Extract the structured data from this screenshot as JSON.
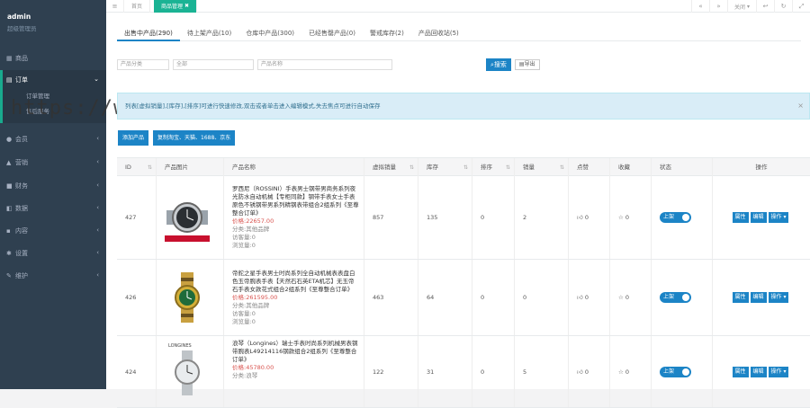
{
  "profile": {
    "name": "admin",
    "role": "超级管理员"
  },
  "sidebar": {
    "items": [
      {
        "label": "商品",
        "icon": "grid-icon"
      },
      {
        "label": "订单",
        "icon": "cart-icon"
      },
      {
        "label": "会员",
        "icon": "user-icon"
      },
      {
        "label": "营销",
        "icon": "flag-icon"
      },
      {
        "label": "财务",
        "icon": "money-icon"
      },
      {
        "label": "数据",
        "icon": "chart-icon"
      },
      {
        "label": "内容",
        "icon": "doc-icon"
      },
      {
        "label": "设置",
        "icon": "gear-icon"
      },
      {
        "label": "维护",
        "icon": "wrench-icon"
      }
    ],
    "sub": [
      "订单管理",
      "售后服务"
    ]
  },
  "topbar": {
    "tabs": [
      "首页",
      "商品管理"
    ],
    "close_label": "关闭"
  },
  "tabs": [
    "出售中产品(290)",
    "待上架产品(10)",
    "仓库中产品(300)",
    "已经售罄产品(0)",
    "警戒库存(2)",
    "产品回收站(5)"
  ],
  "filter": {
    "input1": "产品分类",
    "input2": "全部",
    "input3": "产品名称",
    "search_label": "搜索",
    "export_label": "导出"
  },
  "watermark": "https://www.huzhan.com/ishop23148",
  "alert": {
    "text": "列表[虚拟销量],[库存],[排序]可进行快速修改,双击或者单击进入编辑模式,失去焦点可进行自动保存"
  },
  "buttons": {
    "add": "添加产品",
    "copy": "复制淘宝、天猫、1688、京东"
  },
  "table": {
    "headers": [
      "ID",
      "产品图片",
      "产品名称",
      "虚拟销量",
      "库存",
      "排序",
      "销量",
      "点赞",
      "收藏",
      "状态",
      "操作"
    ],
    "rows": [
      {
        "id": "427",
        "name": "罗西尼（ROSSINI）手表男士钢带男商务系列夜光防水自动机械【专柜同款】钢带手表女士手表原色不锈钢带男系列精钢表带组合2组系列《至尊整合订单》",
        "price": "价格:22657.00",
        "cat": "分类:其他品牌",
        "visits": "访客量:0",
        "views": "浏览量:0",
        "virtual": "857",
        "stock": "135",
        "sort": "0",
        "sales": "2",
        "likes": "0",
        "collects": "0",
        "status": "上架"
      },
      {
        "id": "426",
        "name": "帝舵之星手表男士时尚系列全自动机械表表盘白色玉帝腕表手表【天然石石英ETA机芯】无玉帝石手表女款花式组合2组系列《至尊整合订单》",
        "price": "价格:261595.00",
        "cat": "分类:其他品牌",
        "visits": "访客量:0",
        "views": "浏览量:0",
        "virtual": "463",
        "stock": "64",
        "sort": "0",
        "sales": "0",
        "likes": "0",
        "collects": "0",
        "status": "上架"
      },
      {
        "id": "424",
        "name": "浪琴（Longines）瑞士手表时尚系列机械男表钢带腕表L49214116钢款组合2组系列《至尊整合订单》",
        "price": "价格:45780.00",
        "cat": "分类:浪琴",
        "visits": "",
        "views": "",
        "virtual": "122",
        "stock": "31",
        "sort": "0",
        "sales": "5",
        "likes": "0",
        "collects": "0",
        "status": "上架"
      }
    ],
    "ops": [
      "属性",
      "编辑",
      "操作"
    ]
  }
}
